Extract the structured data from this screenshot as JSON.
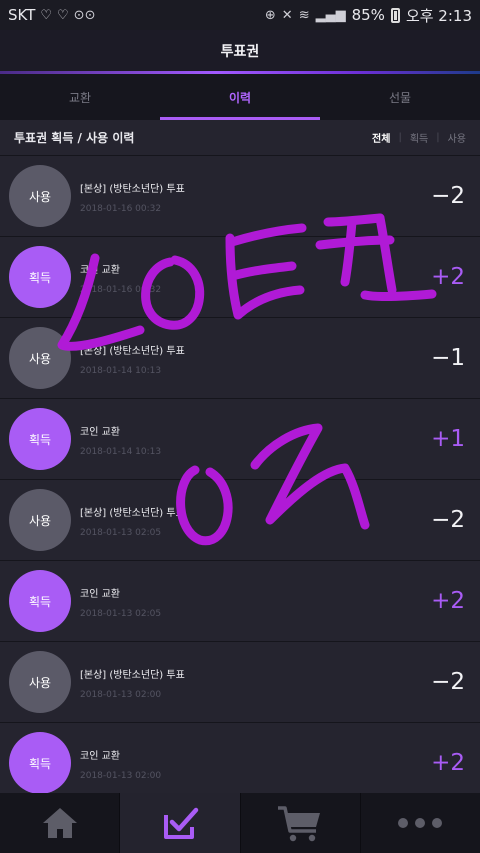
{
  "status_bar": {
    "carrier": "SKT",
    "left_icons": [
      "heart-outline-icon",
      "heart-outline-icon",
      "voicemail-icon"
    ],
    "battery": "85%",
    "time": "오후 2:13"
  },
  "header": {
    "title": "투표권"
  },
  "tabs": [
    {
      "label": "교환",
      "active": false
    },
    {
      "label": "이력",
      "active": true
    },
    {
      "label": "선물",
      "active": false
    }
  ],
  "subheader": {
    "title": "투표권 획득 / 사용 이력",
    "filters": [
      {
        "label": "전체",
        "active": true
      },
      {
        "label": "획득",
        "active": false
      },
      {
        "label": "사용",
        "active": false
      }
    ]
  },
  "history": [
    {
      "badge": "사용",
      "type": "use",
      "title": "[본상] (방탄소년단) 투표",
      "date": "2018-01-16 00:32",
      "amount": "−2"
    },
    {
      "badge": "획득",
      "type": "get",
      "title": "코인 교환",
      "date": "2018-01-16 00:32",
      "amount": "+2"
    },
    {
      "badge": "사용",
      "type": "use",
      "title": "[본상] (방탄소년단) 투표",
      "date": "2018-01-14 10:13",
      "amount": "−1"
    },
    {
      "badge": "획득",
      "type": "get",
      "title": "코인 교환",
      "date": "2018-01-14 10:13",
      "amount": "+1"
    },
    {
      "badge": "사용",
      "type": "use",
      "title": "[본상] (방탄소년단) 투표",
      "date": "2018-01-13 02:05",
      "amount": "−2"
    },
    {
      "badge": "획득",
      "type": "get",
      "title": "코인 교환",
      "date": "2018-01-13 02:05",
      "amount": "+2"
    },
    {
      "badge": "사용",
      "type": "use",
      "title": "[본상] (방탄소년단) 투표",
      "date": "2018-01-13 02:00",
      "amount": "−2"
    },
    {
      "badge": "획득",
      "type": "get",
      "title": "코인 교환",
      "date": "2018-01-13 02:00",
      "amount": "+2"
    }
  ],
  "bottom_nav": [
    {
      "icon": "home-icon",
      "active": false
    },
    {
      "icon": "vote-check-icon",
      "active": true
    },
    {
      "icon": "cart-icon",
      "active": false
    },
    {
      "icon": "more-icon",
      "active": false
    }
  ],
  "colors": {
    "accent": "#a95cf5",
    "background": "#23222e",
    "use_badge": "#5b5a68"
  },
  "overlay": {
    "description_icon": "handwritten-scribble",
    "strokes": "purple freehand writing across list"
  }
}
